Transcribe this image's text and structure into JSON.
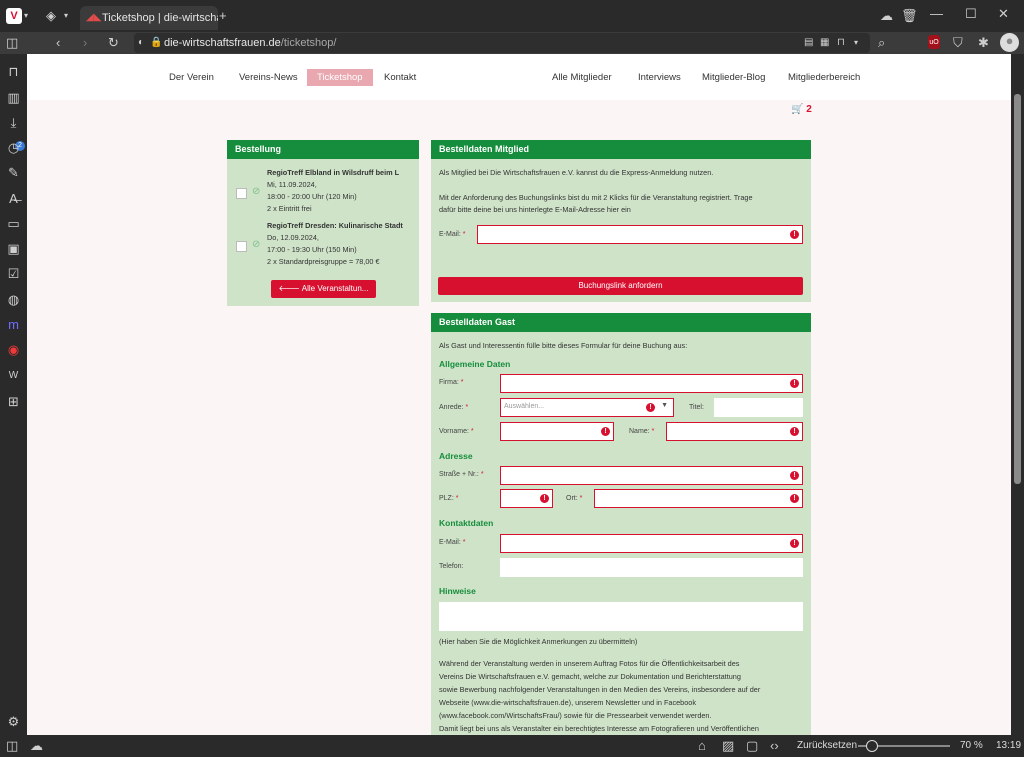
{
  "browser": {
    "tab_title": "Ticketshop | die-wirtschaftsf",
    "url_domain": "die-wirtschaftsfrauen.de",
    "url_path": "/ticketshop/",
    "zoom": "70 %",
    "reset_label": "Zurücksetzen",
    "time": "13:19",
    "sidebar_badge": "2"
  },
  "nav": {
    "left": [
      "Der Verein",
      "Vereins-News",
      "Ticketshop",
      "Kontakt"
    ],
    "right": [
      "Alle Mitglieder",
      "Interviews",
      "Mitglieder-Blog",
      "Mitgliederbereich"
    ],
    "cart_count": "2"
  },
  "order": {
    "title": "Bestellung",
    "items": [
      {
        "name": "RegioTreff Elbland in Wilsdruff beim L",
        "date": "Mi, 11.09.2024,",
        "time": "18:00 - 20:00 Uhr (120 Min)",
        "qty": "2 x Eintritt frei"
      },
      {
        "name": "RegioTreff Dresden: Kulinarische Stadt",
        "date": "Do, 12.09.2024,",
        "time": "17:00 - 19:30 Uhr (150 Min)",
        "qty": "2 x Standardpreisgruppe = 78,00 €"
      }
    ],
    "back_button": "Alle Veranstaltun..."
  },
  "member": {
    "title": "Bestelldaten Mitglied",
    "intro": "Als Mitglied bei Die Wirtschaftsfrauen e.V. kannst du die Express-Anmeldung nutzen.",
    "info1": "Mit der Anforderung des Buchungslinks bist du mit 2 Klicks für die Veranstaltung registriert. Trage",
    "info2": "dafür bitte deine bei uns hinterlegte E-Mail-Adresse hier ein",
    "email_label": "E-Mail:",
    "button": "Buchungslink anfordern"
  },
  "guest": {
    "title": "Bestelldaten Gast",
    "intro": "Als Gast und Interessentin fülle bitte dieses Formular für deine Buchung aus:",
    "sec_general": "Allgemeine Daten",
    "firma": "Firma:",
    "anrede": "Anrede:",
    "anrede_placeholder": "Auswählen...",
    "titel": "Titel:",
    "vorname": "Vorname:",
    "name": "Name:",
    "sec_address": "Adresse",
    "strasse": "Straße + Nr.:",
    "plz": "PLZ:",
    "ort": "Ort:",
    "sec_contact": "Kontaktdaten",
    "email": "E-Mail:",
    "telefon": "Telefon:",
    "sec_notes": "Hinweise",
    "notes_hint": "(Hier haben Sie die Möglichkeit Anmerkungen zu übermitteln)",
    "photo_lines": [
      "Während der Veranstaltung werden in unserem Auftrag Fotos für die Öffentlichkeitsarbeit des",
      "Vereins Die Wirtschaftsfrauen e.V. gemacht, welche zur Dokumentation und Berichterstattung",
      "sowie Bewerbung nachfolgender Veranstaltungen in den Medien des Vereins, insbesondere auf der",
      "Webseite (www.die-wirtschaftsfrauen.de), unserem Newsletter und in Facebook",
      "(www.facebook.com/WirtschaftsFrau/) sowie für die Pressearbeit verwendet werden.",
      "Damit liegt bei uns als Veranstalter ein berechtigtes Interesse am Fotografieren und Veröffentlichen"
    ]
  }
}
